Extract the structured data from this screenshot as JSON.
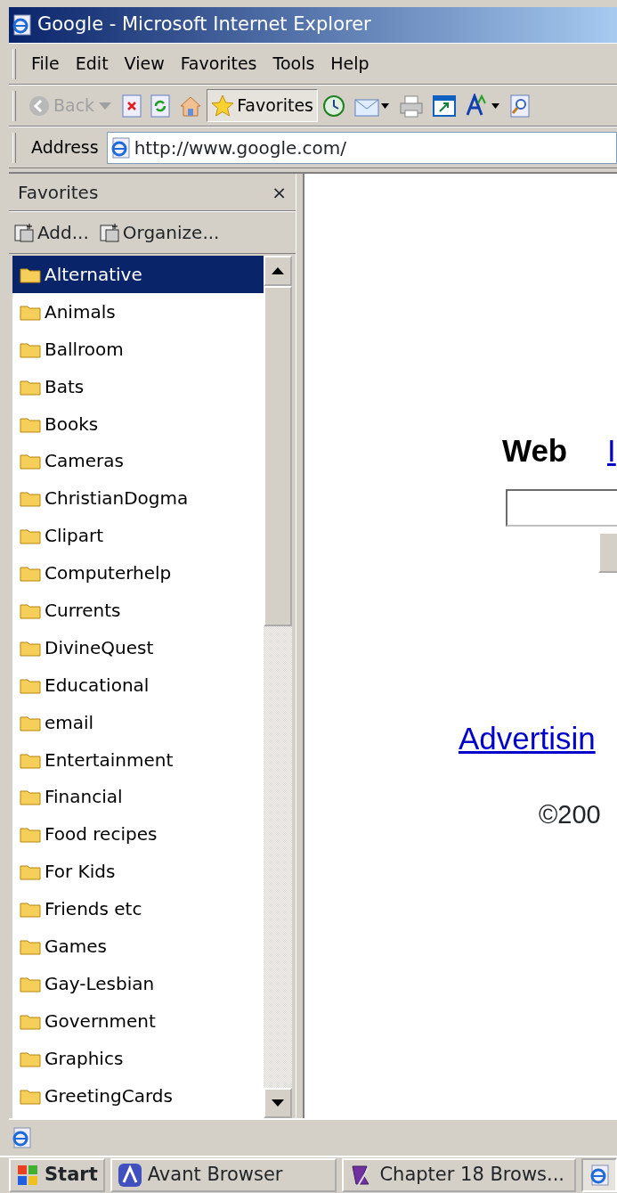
{
  "window": {
    "title": "Google - Microsoft Internet Explorer"
  },
  "menu": [
    "File",
    "Edit",
    "View",
    "Favorites",
    "Tools",
    "Help"
  ],
  "toolbar": [
    {
      "kind": "back",
      "label": "Back",
      "disabled": true,
      "pressed": false
    },
    {
      "kind": "stop",
      "pressed": false
    },
    {
      "kind": "refresh",
      "pressed": false
    },
    {
      "kind": "home",
      "pressed": false
    },
    {
      "kind": "favorites",
      "label": "Favorites",
      "pressed": true
    },
    {
      "kind": "history",
      "pressed": false
    },
    {
      "kind": "mail",
      "pressed": false
    },
    {
      "kind": "print",
      "pressed": false
    },
    {
      "kind": "window",
      "pressed": false
    },
    {
      "kind": "font",
      "pressed": false
    },
    {
      "kind": "research",
      "pressed": false
    }
  ],
  "address": {
    "label": "Address",
    "value": "http://www.google.com/"
  },
  "favorites_pane": {
    "title": "Favorites",
    "close": "×",
    "actions": [
      "Add...",
      "Organize..."
    ],
    "items": [
      {
        "label": "Alternative",
        "selected": true
      },
      {
        "label": "Animals",
        "selected": false
      },
      {
        "label": "Ballroom",
        "selected": false
      },
      {
        "label": "Bats",
        "selected": false
      },
      {
        "label": "Books",
        "selected": false
      },
      {
        "label": "Cameras",
        "selected": false
      },
      {
        "label": "ChristianDogma",
        "selected": false
      },
      {
        "label": "Clipart",
        "selected": false
      },
      {
        "label": "Computerhelp",
        "selected": false
      },
      {
        "label": "Currents",
        "selected": false
      },
      {
        "label": "DivineQuest",
        "selected": false
      },
      {
        "label": "Educational",
        "selected": false
      },
      {
        "label": "email",
        "selected": false
      },
      {
        "label": "Entertainment",
        "selected": false
      },
      {
        "label": "Financial",
        "selected": false
      },
      {
        "label": "Food recipes",
        "selected": false
      },
      {
        "label": "For Kids",
        "selected": false
      },
      {
        "label": "Friends etc",
        "selected": false
      },
      {
        "label": "Games",
        "selected": false
      },
      {
        "label": "Gay-Lesbian",
        "selected": false
      },
      {
        "label": "Government",
        "selected": false
      },
      {
        "label": "Graphics",
        "selected": false
      },
      {
        "label": "GreetingCards",
        "selected": false
      }
    ]
  },
  "page": {
    "tabs": [
      {
        "label": "Web",
        "selected": true
      },
      {
        "label": "I",
        "selected": false
      }
    ],
    "link": "Advertisin",
    "copyright": "©200"
  },
  "taskbar": {
    "start": "Start",
    "items": [
      {
        "label": "Avant Browser",
        "kind": "avant",
        "active": false
      },
      {
        "label": "Chapter 18 Brows...",
        "kind": "doc",
        "active": false
      },
      {
        "kind": "ie",
        "active": true
      }
    ]
  }
}
